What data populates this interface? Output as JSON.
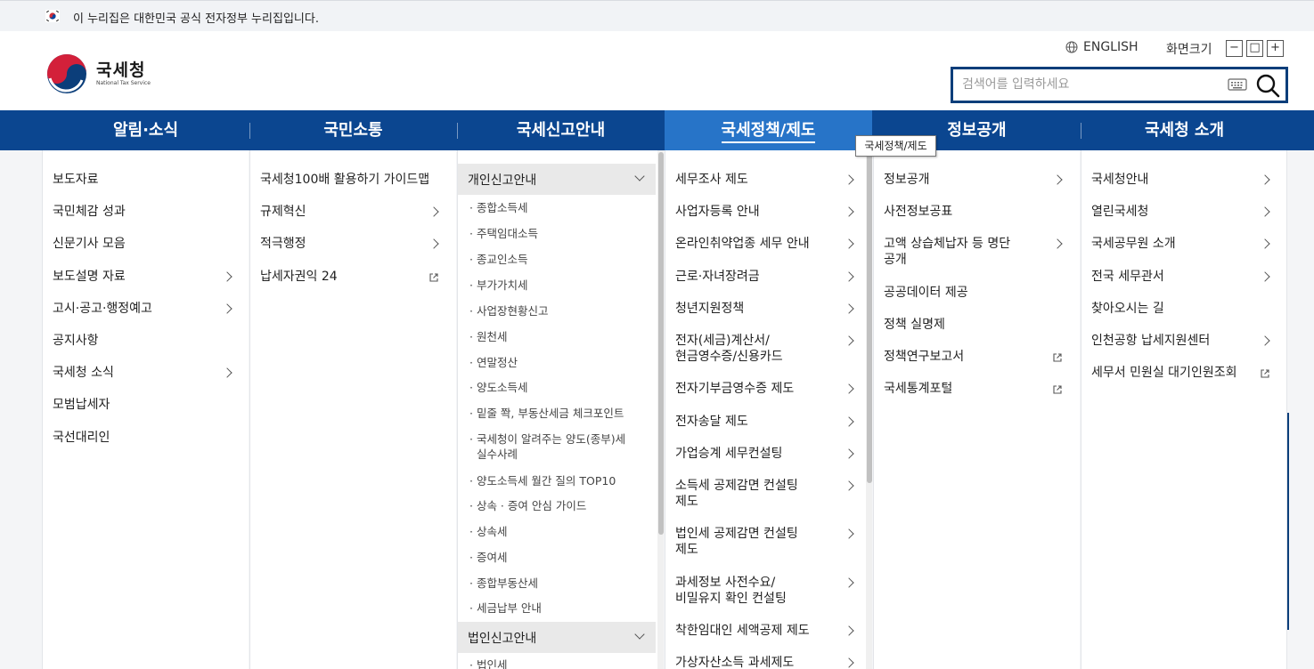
{
  "gov_banner": {
    "text": "이 누리집은 대한민국 공식 전자정부 누리집입니다."
  },
  "logo": {
    "title": "국세청",
    "subtitle": "National Tax Service"
  },
  "util": {
    "lang": "ENGLISH",
    "font_size_label": "화면크기",
    "minus": "−",
    "reset": "□",
    "plus": "+"
  },
  "search": {
    "placeholder": "검색어를 입력하세요"
  },
  "gnb": [
    "알림·소식",
    "국민소통",
    "국세신고안내",
    "국세정책/제도",
    "정보공개",
    "국세청 소개"
  ],
  "tooltip": "국세정책/제도",
  "col1": [
    "보도자료",
    "국민체감 성과",
    "신문기사 모음",
    "보도설명 자료",
    "고시·공고·행정예고",
    "공지사항",
    "국세청 소식",
    "모범납세자",
    "국선대리인"
  ],
  "col2": [
    "국세청100배 활용하기 가이드맵",
    "규제혁신",
    "적극행정",
    "납세자권익 24"
  ],
  "col3": {
    "head1": "개인신고안내",
    "subs": [
      "· 종합소득세",
      "· 주택임대소득",
      "· 종교인소득",
      "· 부가가치세",
      "· 사업장현황신고",
      "· 원천세",
      "· 연말정산",
      "· 양도소득세",
      "· 밑줄 쫙, 부동산세금 체크포인트",
      "· 국세청이 알려주는 양도(종부)세",
      "실수사례",
      "· 양도소득세 월간 질의 TOP10",
      "· 상속 · 증여 안심 가이드",
      "· 상속세",
      "· 증여세",
      "· 종합부동산세",
      "· 세금납부 안내"
    ],
    "head2": "법인신고안내",
    "last_sub": "· 법인세"
  },
  "col4": [
    "세무조사 제도",
    "사업자등록 안내",
    "온라인취약업종 세무 안내",
    "근로·자녀장려금",
    "청년지원정책",
    "전자(세금)계산서/",
    "현금영수증/신용카드",
    "전자기부금영수증 제도",
    "전자송달 제도",
    "가업승계 세무컨설팅",
    "소득세 공제감면 컨설팅",
    "제도",
    "법인세 공제감면 컨설팅",
    "제도",
    "과세정보 사전수요/",
    "비밀유지 확인 컨설팅",
    "착한임대인 세액공제 제도",
    "가상자산소득 과세제도"
  ],
  "col5": [
    "정보공개",
    "사전정보공표",
    "고액 상습체납자 등 명단",
    "공개",
    "공공데이터 제공",
    "정책 실명제",
    "정책연구보고서",
    "국세통계포털"
  ],
  "col6": [
    "국세청안내",
    "열린국세청",
    "국세공무원 소개",
    "전국 세무관서",
    "찾아오시는 길",
    "인천공항 납세지원센터",
    "세무서 민원실 대기인원조회"
  ]
}
